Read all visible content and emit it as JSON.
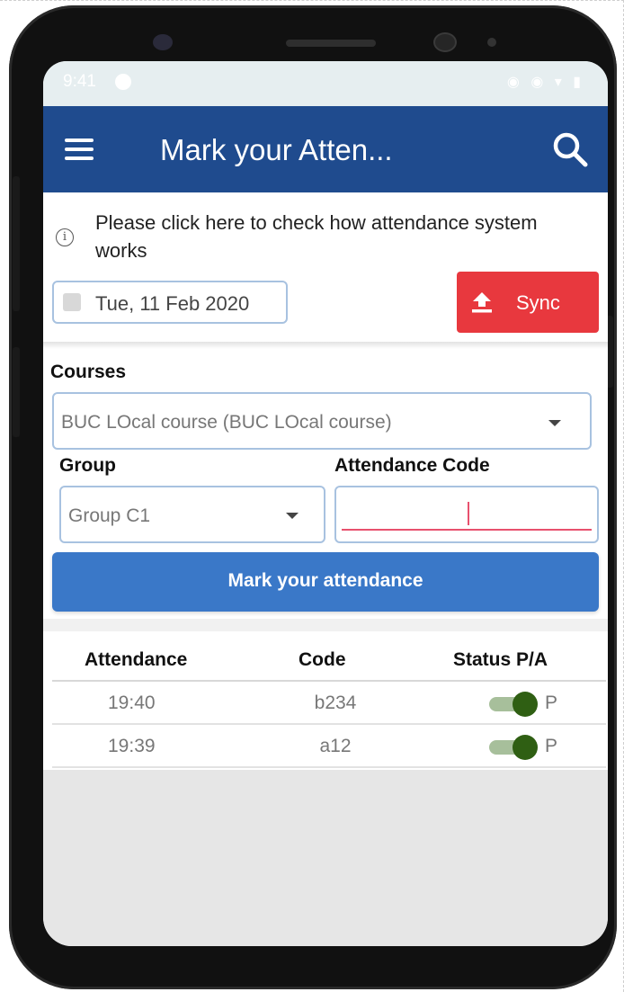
{
  "statusbar": {
    "time": "9:41"
  },
  "appbar": {
    "title": "Mark your Atten..."
  },
  "info": {
    "text": "Please click here to check how attendance system works"
  },
  "date": {
    "value": "Tue, 11 Feb 2020"
  },
  "sync": {
    "label": "Sync"
  },
  "courses": {
    "label": "Courses",
    "selected": "BUC LOcal course (BUC LOcal course)"
  },
  "group": {
    "label": "Group",
    "selected": "Group C1"
  },
  "attendance_code": {
    "label": "Attendance Code",
    "value": ""
  },
  "mark_button": {
    "label": "Mark your attendance"
  },
  "table": {
    "headers": [
      "Attendance",
      "Code",
      "Status P/A"
    ],
    "rows": [
      {
        "time": "19:40",
        "code": "b234",
        "status": "P",
        "toggle_on": true
      },
      {
        "time": "19:39",
        "code": "a12",
        "status": "P",
        "toggle_on": true
      }
    ]
  },
  "colors": {
    "appbar": "#1f4b8e",
    "sync_button": "#e8383e",
    "mark_button": "#3a78c8",
    "toggle_knob": "#2f5f13",
    "code_underline": "#e8516e"
  },
  "icons": [
    "menu-icon",
    "search-icon",
    "info-icon",
    "calendar-icon",
    "upload-icon",
    "chevron-down-icon"
  ]
}
